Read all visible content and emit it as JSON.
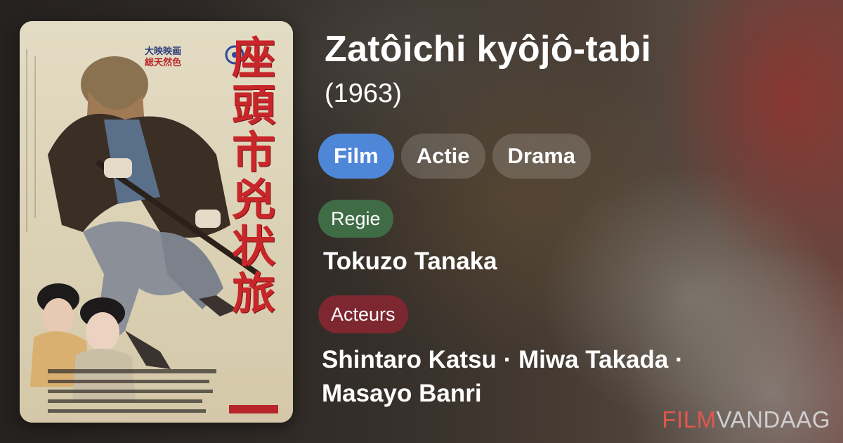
{
  "movie": {
    "title": "Zatôichi kyôjô-tabi",
    "year": "(1963)"
  },
  "poster": {
    "title_chars": [
      "座",
      "頭",
      "市",
      "兇",
      "状",
      "旅"
    ],
    "studio_line_1": "大映映画",
    "studio_line_2": "総天然色"
  },
  "genres": [
    "Film",
    "Actie",
    "Drama"
  ],
  "director": {
    "label": "Regie",
    "name": "Tokuzo Tanaka"
  },
  "cast": {
    "label": "Acteurs",
    "names": "Shintaro Katsu · Miwa Takada · Masayo Banri"
  },
  "brand": {
    "part1": "FILM",
    "part2": "VANDAAG"
  },
  "colors": {
    "genre_primary": "#4f87d8",
    "regie_tag": "#3f6b45",
    "actors_tag": "#7d2730",
    "brand_red": "#e0574f"
  }
}
